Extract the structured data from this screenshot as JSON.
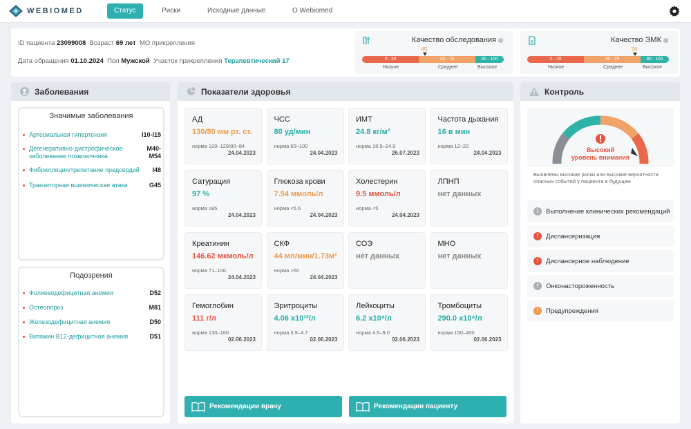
{
  "header": {
    "logo_text": "WEBIOMED",
    "nav": [
      "Статус",
      "Риски",
      "Исходные данные",
      "О Webiomed"
    ]
  },
  "patient": {
    "id_label": "ID пациента",
    "id": "23099008",
    "age_label": "Возраст",
    "age": "69 лет",
    "mo_label": "МО прикрепления",
    "date_label": "Дата обращения",
    "date": "01.10.2024",
    "sex_label": "Пол",
    "sex": "Мужской",
    "area_label": "Участок прикрепления",
    "area": "Терапевтический 17"
  },
  "quality": [
    {
      "title": "Качество обследования",
      "value": "45",
      "fraction": 0.45
    },
    {
      "title": "Качество ЭМК",
      "value": "76",
      "fraction": 0.76
    }
  ],
  "quality_scale": {
    "ranges": [
      "0 - 39",
      "40 - 79",
      "80 - 100"
    ],
    "labels": [
      "Низкое",
      "Среднее",
      "Высокое"
    ],
    "colors": [
      "#e9674b",
      "#f1a268",
      "#2fb3a8"
    ]
  },
  "diseases": {
    "title": "Заболевания",
    "main_title": "Значимые заболевания",
    "main": [
      {
        "name": "Артериальная гипертензия",
        "code": "I10-I15"
      },
      {
        "name": "Дегенеративно-дистрофическое заболевание позвоночника",
        "code": "M40-M54"
      },
      {
        "name": "Фибрилляция/трепетание предсердий",
        "code": "I48"
      },
      {
        "name": "Транзиторная ишемическая атака",
        "code": "G45"
      }
    ],
    "susp_title": "Подозрения",
    "suspicions": [
      {
        "name": "Фолиеводефицитная анемия",
        "code": "D52"
      },
      {
        "name": "Остеопороз",
        "code": "M81"
      },
      {
        "name": "Железодефицитная анемия",
        "code": "D50"
      },
      {
        "name": "Витамин B12-дефицитная анемия",
        "code": "D51"
      }
    ]
  },
  "health": {
    "title": "Показатели здоровья",
    "tiles": [
      {
        "name": "АД",
        "value": "130/80 мм рт. ст.",
        "norm": "норма 120–129/80–84",
        "date": "24.04.2023",
        "color": "c-or"
      },
      {
        "name": "ЧСС",
        "value": "80 уд/мин",
        "norm": "норма 60–100",
        "date": "24.04.2023",
        "color": "c-te"
      },
      {
        "name": "ИМТ",
        "value": "24.8 кг/м²",
        "norm": "норма 18.5–24.9",
        "date": "26.07.2023",
        "color": "c-te"
      },
      {
        "name": "Частота дыхания",
        "value": "16 в мин",
        "norm": "норма 12–20",
        "date": "24.04.2023",
        "color": "c-te"
      },
      {
        "name": "Сатурация",
        "value": "97 %",
        "norm": "норма ≥95",
        "date": "24.04.2023",
        "color": "c-te"
      },
      {
        "name": "Глюкоза крови",
        "value": "7.54 ммоль/л",
        "norm": "норма <5.6",
        "date": "24.04.2023",
        "color": "c-or"
      },
      {
        "name": "Холестерин",
        "value": "9.5 ммоль/л",
        "norm": "норма <5",
        "date": "24.04.2023",
        "color": "c-re"
      },
      {
        "name": "ЛПНП",
        "value": "нет данных",
        "norm": "",
        "date": "",
        "color": "c-gr"
      },
      {
        "name": "Креатинин",
        "value": "146.62 мкмоль/л",
        "norm": "норма 71–106",
        "date": "24.04.2023",
        "color": "c-re"
      },
      {
        "name": "СКФ",
        "value": "44 мл/мин/1.73м²",
        "norm": "норма >60",
        "date": "24.04.2023",
        "color": "c-or"
      },
      {
        "name": "СОЭ",
        "value": "нет данных",
        "norm": "",
        "date": "",
        "color": "c-gr"
      },
      {
        "name": "МНО",
        "value": "нет данных",
        "norm": "",
        "date": "",
        "color": "c-gr"
      },
      {
        "name": "Гемоглобин",
        "value": "111 г/л",
        "norm": "норма 130–160",
        "date": "02.06.2023",
        "color": "c-re"
      },
      {
        "name": "Эритроциты",
        "value": "4.06 x10¹²/л",
        "norm": "норма 3.9–4.7",
        "date": "02.06.2023",
        "color": "c-te"
      },
      {
        "name": "Лейкоциты",
        "value": "6.2 x10⁹/л",
        "norm": "норма 4.5–9.0",
        "date": "02.06.2023",
        "color": "c-te"
      },
      {
        "name": "Тромбоциты",
        "value": "290.0 x10⁹/л",
        "norm": "норма 150–400",
        "date": "02.06.2023",
        "color": "c-te"
      }
    ],
    "btn_doctor": "Рекомендации врачу",
    "btn_patient": "Рекомендации пациенту"
  },
  "control": {
    "title": "Контроль",
    "gauge_line1": "Высокий",
    "gauge_line2": "уровень внимания",
    "note": "Выявлены высокие риски или высокие вероятности опасных событий у пациента в будущем",
    "items": [
      {
        "label": "Выполнение клинических рекомендаций",
        "color": "#a9b0b8"
      },
      {
        "label": "Диспансеризация",
        "color": "#e4543f"
      },
      {
        "label": "Диспансерное наблюдение",
        "color": "#e4543f"
      },
      {
        "label": "Онконастороженность",
        "color": "#a9b0b8"
      },
      {
        "label": "Предупреждения",
        "color": "#ee9a4d"
      }
    ]
  }
}
